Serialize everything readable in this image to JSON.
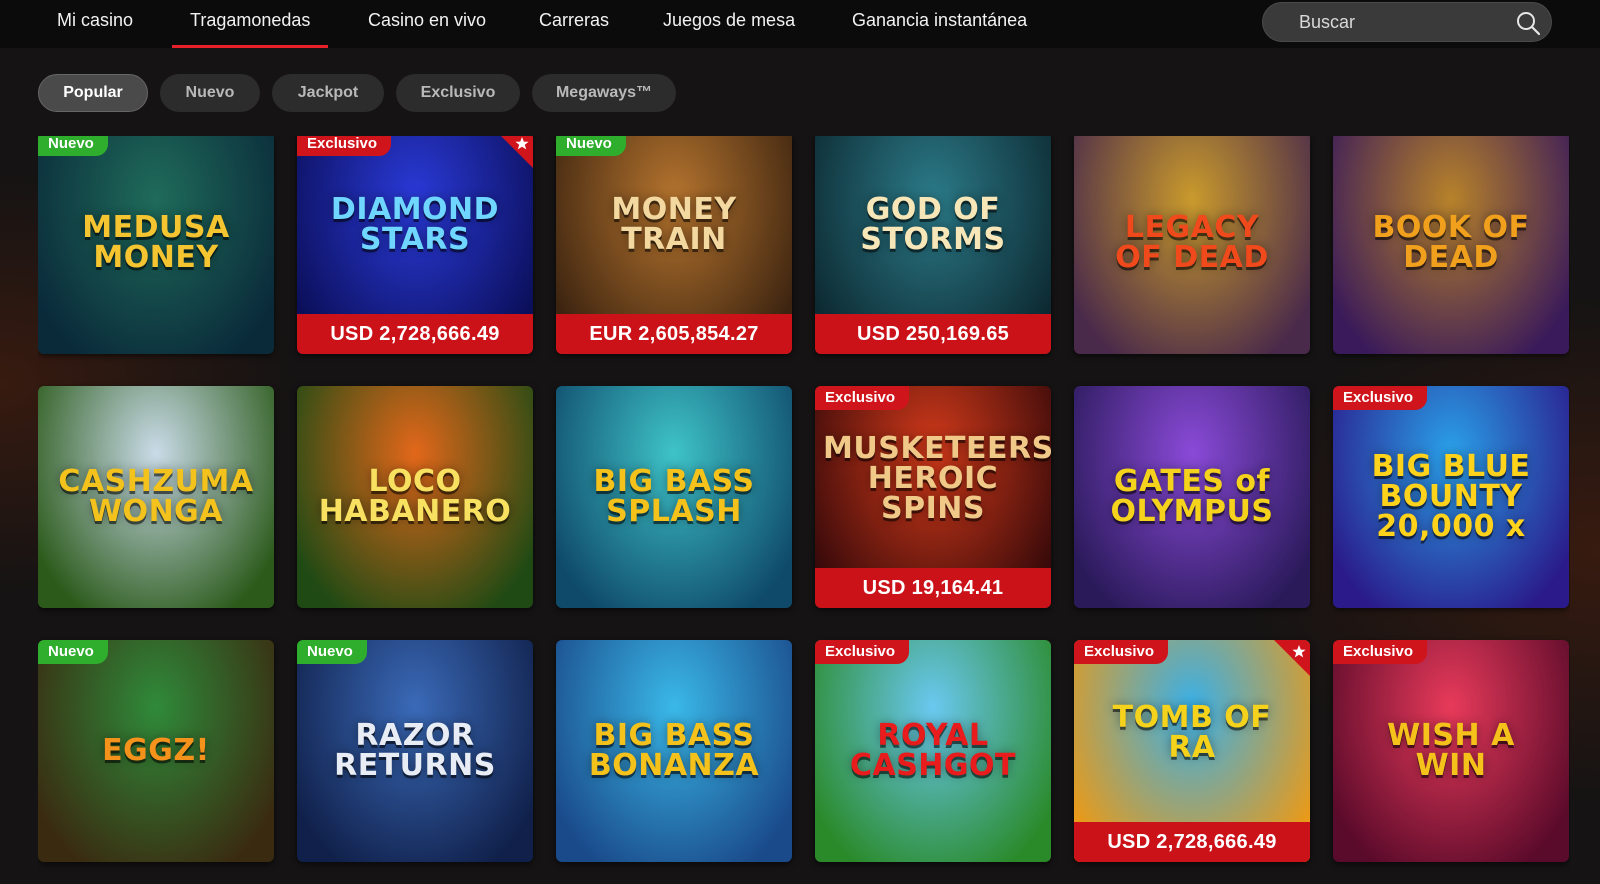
{
  "nav": {
    "items": [
      {
        "label": "Mi casino"
      },
      {
        "label": "Tragamonedas",
        "active": true
      },
      {
        "label": "Casino en vivo"
      },
      {
        "label": "Carreras"
      },
      {
        "label": "Juegos de mesa"
      },
      {
        "label": "Ganancia instantánea"
      }
    ],
    "search_placeholder": "Buscar",
    "search_icon": "search-icon"
  },
  "filters": [
    {
      "label": "Popular",
      "active": true
    },
    {
      "label": "Nuevo"
    },
    {
      "label": "Jackpot"
    },
    {
      "label": "Exclusivo"
    },
    {
      "label": "Megaways™"
    }
  ],
  "colors": {
    "accent": "#e8202a",
    "badge_new": "#2fae2e",
    "badge_exclusive": "#d0141c",
    "jackpot_bar": "#cc1219"
  },
  "games": [
    {
      "title": "MEDUSA\nMONEY",
      "badge": "Nuevo",
      "jackpot": "",
      "bg1": "#1f6b5a",
      "bg2": "#0a2a3a",
      "color": "#f5c431"
    },
    {
      "title": "DIAMOND\nSTARS",
      "badge": "Exclusivo",
      "jackpot": "USD 2,728,666.49",
      "star": true,
      "bg1": "#2a3ad8",
      "bg2": "#0b0f5a",
      "color": "#6fd6ff"
    },
    {
      "title": "MONEY\nTRAIN",
      "badge": "Nuevo",
      "jackpot": "EUR 2,605,854.27",
      "bg1": "#b5742e",
      "bg2": "#3d2410",
      "color": "#f3d9a0"
    },
    {
      "title": "GOD OF\nSTORMS",
      "badge": "",
      "jackpot": "USD 250,169.65",
      "bg1": "#2b7a88",
      "bg2": "#0d2a32",
      "color": "#f7e7b8"
    },
    {
      "title": "LEGACY\nOF DEAD",
      "badge": "",
      "jackpot": "",
      "bg1": "#c99a2c",
      "bg2": "#4a2a4a",
      "color": "#f04a1c"
    },
    {
      "title": "BOOK OF\nDEAD",
      "badge": "",
      "jackpot": "",
      "bg1": "#b7822a",
      "bg2": "#3a1a5a",
      "color": "#f0a01c"
    },
    {
      "title": "CASHZUMA\nWONGA",
      "badge": "",
      "jackpot": "",
      "bg1": "#c9dbe8",
      "bg2": "#2b5a1a",
      "color": "#f3c21c"
    },
    {
      "title": "LOCO\nHABANERO",
      "badge": "",
      "jackpot": "",
      "bg1": "#e2671a",
      "bg2": "#1f4a14",
      "color": "#f8e060"
    },
    {
      "title": "BIG BASS\nSPLASH",
      "badge": "",
      "jackpot": "",
      "bg1": "#3ec3c8",
      "bg2": "#0f4a6a",
      "color": "#f5c21c"
    },
    {
      "title": "MUSKETEERS\nHEROIC SPINS",
      "badge": "Exclusivo",
      "jackpot": "USD 19,164.41",
      "bg1": "#d23a1a",
      "bg2": "#3a0a0a",
      "color": "#f0c888"
    },
    {
      "title": "GATES of\nOLYMPUS",
      "badge": "",
      "jackpot": "",
      "bg1": "#8a4ad8",
      "bg2": "#2a1a5a",
      "color": "#f5d21c"
    },
    {
      "title": "BIG BLUE\nBOUNTY\n20,000 x",
      "badge": "Exclusivo",
      "jackpot": "",
      "bg1": "#2aa0e8",
      "bg2": "#2a1a8a",
      "color": "#ffd21c"
    },
    {
      "title": "EGGZ!",
      "badge": "Nuevo",
      "jackpot": "",
      "bg1": "#2f8a3a",
      "bg2": "#3a2a10",
      "color": "#f5921c"
    },
    {
      "title": "RAZOR\nRETURNS",
      "badge": "Nuevo",
      "jackpot": "",
      "bg1": "#3a6ab8",
      "bg2": "#10204a",
      "color": "#e8ecf5"
    },
    {
      "title": "BIG BASS\nBONANZA",
      "badge": "",
      "jackpot": "",
      "bg1": "#3ab8e8",
      "bg2": "#1a4a8a",
      "color": "#f5c21c"
    },
    {
      "title": "ROYAL\nCASHGOT",
      "badge": "Exclusivo",
      "jackpot": "",
      "bg1": "#6ac8f0",
      "bg2": "#2a8a2a",
      "color": "#e81c1c"
    },
    {
      "title": "TOMB OF\nRA",
      "badge": "Exclusivo",
      "jackpot": "USD 2,728,666.49",
      "star": true,
      "bg1": "#3ab0e8",
      "bg2": "#e89a1a",
      "color": "#f5d21c"
    },
    {
      "title": "WISH A\nWIN",
      "badge": "Exclusivo",
      "jackpot": "",
      "bg1": "#e83a5a",
      "bg2": "#5a0a2a",
      "color": "#f5c21c"
    }
  ]
}
